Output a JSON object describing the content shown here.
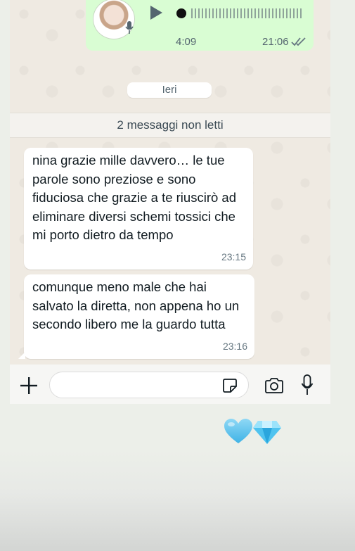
{
  "voice_message": {
    "duration": "4:09",
    "time": "21:06",
    "status_icon": "double-check-icon"
  },
  "date_separator": "Ieri",
  "unread_banner": "2 messaggi non letti",
  "messages": [
    {
      "text": "nina grazie mille davvero… le tue parole sono preziose e sono fiduciosa che grazie a te riuscirò ad eliminare diversi schemi tossici che mi porto dietro da tempo",
      "time": "23:15"
    },
    {
      "text": "comunque meno male che hai salvato la diretta, non appena ho un secondo libero me la guardo tutta",
      "time": "23:16"
    }
  ],
  "composer": {
    "placeholder": "",
    "icons": [
      "plus-icon",
      "sticker-icon",
      "camera-icon",
      "microphone-icon"
    ]
  },
  "reactions": [
    "light-blue-heart-emoji",
    "gem-emoji"
  ],
  "colors": {
    "outgoing_bubble": "#d9fdd3",
    "incoming_bubble": "#ffffff",
    "chat_background": "#efeae2",
    "icon": "#54656f"
  }
}
